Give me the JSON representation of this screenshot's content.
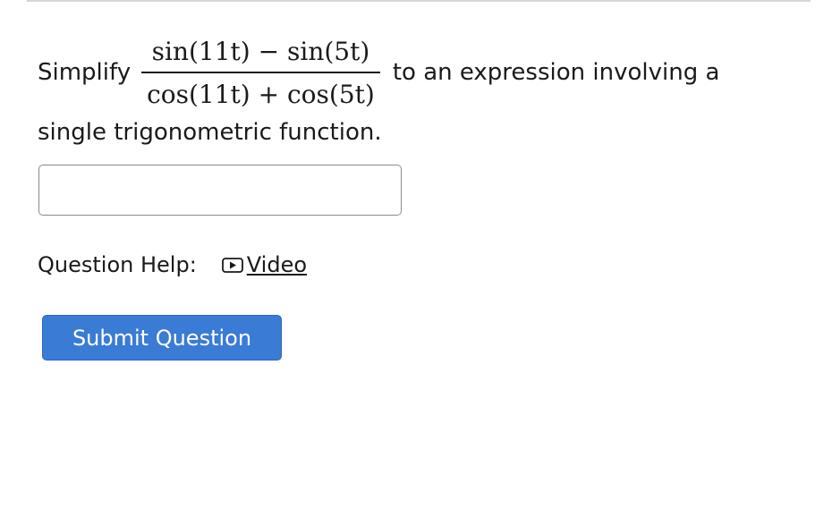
{
  "question": {
    "prefix": "Simplify",
    "numerator": "sin(11t) − sin(5t)",
    "denominator": "cos(11t) + cos(5t)",
    "suffix": "to an expression involving a",
    "continuation": "single trigonometric function."
  },
  "answer": {
    "value": "",
    "placeholder": ""
  },
  "help": {
    "label": "Question Help:",
    "video_label": "Video",
    "icon": "play-icon"
  },
  "submit": {
    "label": "Submit Question",
    "color": "#3a7bd5"
  }
}
